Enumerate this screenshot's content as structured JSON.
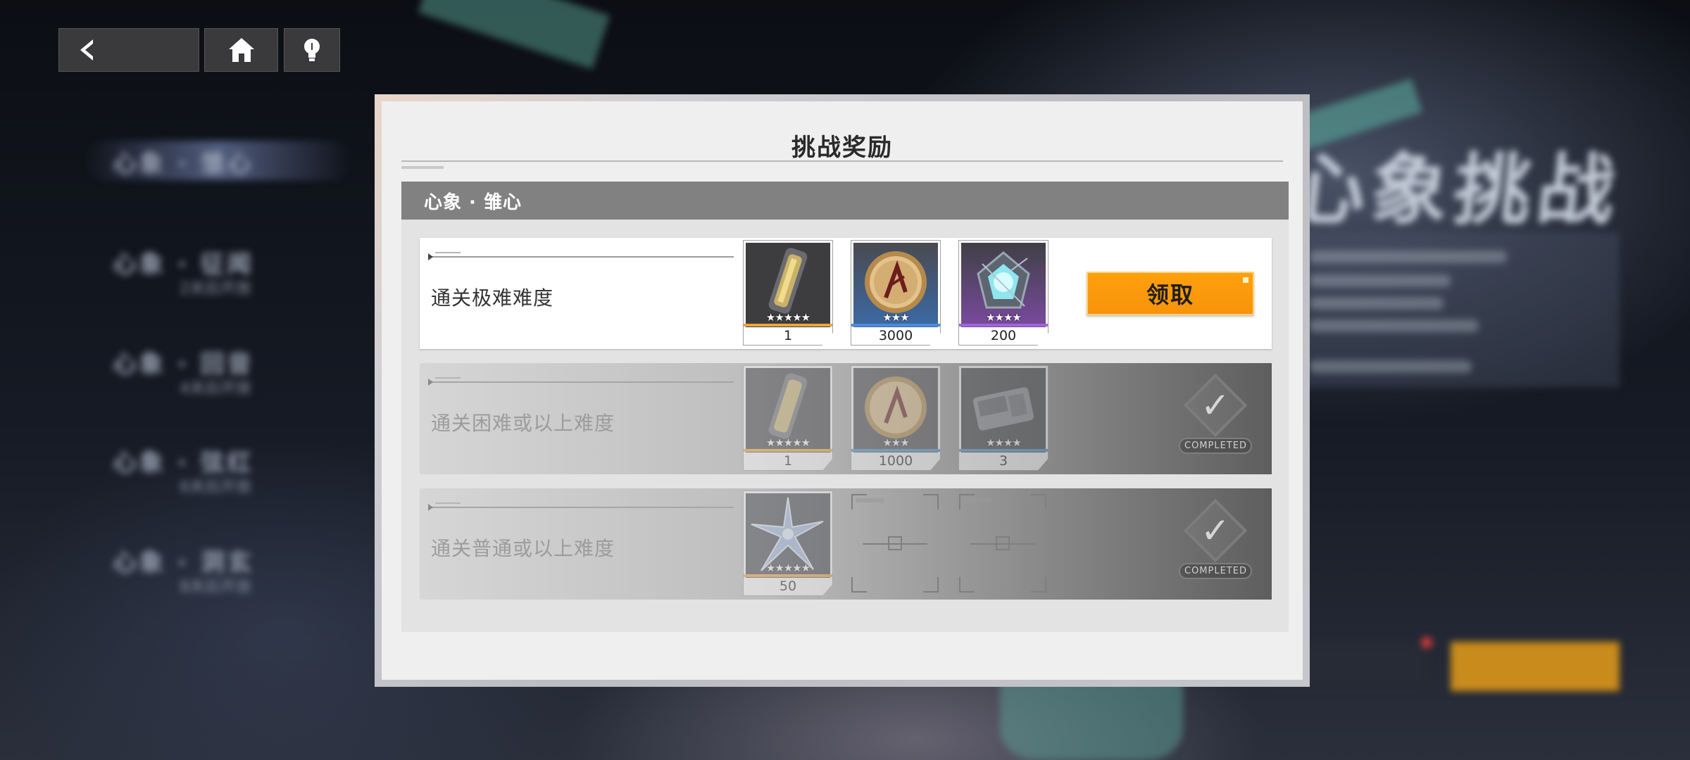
{
  "background": {
    "page_title": "心象挑战",
    "sidebar": [
      {
        "label": "心象 · 雏心"
      },
      {
        "label": "心象 · 征闻",
        "sub": "2关后开放"
      },
      {
        "label": "心象 · 回音",
        "sub": "4关后开放"
      },
      {
        "label": "心象 · 弦红",
        "sub": "6关后开放"
      },
      {
        "label": "心象 · 洞玄",
        "sub": "8关后开放"
      }
    ]
  },
  "nav": {
    "back": "back-arrow-icon",
    "home": "home-icon",
    "tips": "lightbulb-icon"
  },
  "dialog": {
    "title": "挑战奖励",
    "section_title": "心象 · 雏心",
    "claim_label": "领取",
    "completed_label": "COMPLETED",
    "rows": [
      {
        "label": "通关极难难度",
        "status": "claimable",
        "items": [
          {
            "icon": "golden-capsule-icon",
            "stars": "★★★★★",
            "qty": "1",
            "rarity_color": "#f0a43a"
          },
          {
            "icon": "gold-coin-icon",
            "stars": "★★★",
            "qty": "3000",
            "rarity_color": "#4f8bd6"
          },
          {
            "icon": "crystal-gem-icon",
            "stars": "★★★★",
            "qty": "200",
            "rarity_color": "#a266d8"
          }
        ]
      },
      {
        "label": "通关困难或以上难度",
        "status": "completed",
        "items": [
          {
            "icon": "golden-capsule-icon",
            "stars": "★★★★★",
            "qty": "1",
            "rarity_color": "#f0a43a"
          },
          {
            "icon": "gold-coin-icon",
            "stars": "★★★",
            "qty": "1000",
            "rarity_color": "#4f8bd6"
          },
          {
            "icon": "exp-chip-icon",
            "stars": "★★★★",
            "qty": "3",
            "rarity_color": "#4f8bd6"
          }
        ]
      },
      {
        "label": "通关普通或以上难度",
        "status": "completed",
        "items": [
          {
            "icon": "blue-star-shard-icon",
            "stars": "★★★★★",
            "qty": "50",
            "rarity_color": "#f0a43a"
          }
        ]
      }
    ]
  },
  "colors": {
    "accent_orange": "#f7930a",
    "section_header": "#818181",
    "dialog_bg": "#efefef"
  }
}
